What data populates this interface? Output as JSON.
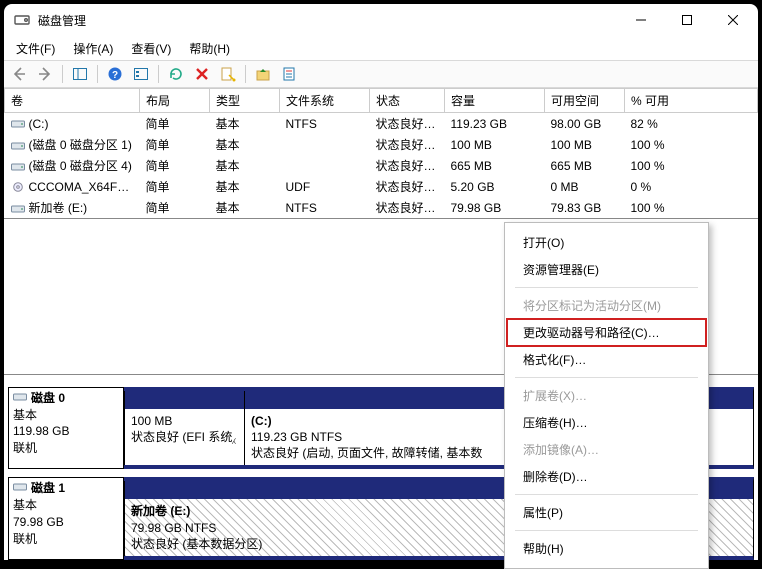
{
  "title": "磁盘管理",
  "menus": {
    "file": "文件(F)",
    "action": "操作(A)",
    "view": "查看(V)",
    "help": "帮助(H)"
  },
  "columns": {
    "volume": "卷",
    "layout": "布局",
    "type": "类型",
    "fs": "文件系统",
    "status": "状态",
    "capacity": "容量",
    "free": "可用空间",
    "pct": "% 可用"
  },
  "volumes": [
    {
      "name": "(C:)",
      "layout": "简单",
      "type": "基本",
      "fs": "NTFS",
      "status": "状态良好 (…",
      "capacity": "119.23 GB",
      "free": "98.00 GB",
      "pct": "82 %",
      "icon": "drive"
    },
    {
      "name": "(磁盘 0 磁盘分区 1)",
      "layout": "简单",
      "type": "基本",
      "fs": "",
      "status": "状态良好 (…",
      "capacity": "100 MB",
      "free": "100 MB",
      "pct": "100 %",
      "icon": "drive"
    },
    {
      "name": "(磁盘 0 磁盘分区 4)",
      "layout": "简单",
      "type": "基本",
      "fs": "",
      "status": "状态良好 (…",
      "capacity": "665 MB",
      "free": "665 MB",
      "pct": "100 %",
      "icon": "drive"
    },
    {
      "name": "CCCOMA_X64FR…",
      "layout": "简单",
      "type": "基本",
      "fs": "UDF",
      "status": "状态良好 (…",
      "capacity": "5.20 GB",
      "free": "0 MB",
      "pct": "0 %",
      "icon": "cd"
    },
    {
      "name": "新加卷 (E:)",
      "layout": "简单",
      "type": "基本",
      "fs": "NTFS",
      "status": "状态良好 (…",
      "capacity": "79.98 GB",
      "free": "79.83 GB",
      "pct": "100 %",
      "icon": "drive"
    }
  ],
  "disks": [
    {
      "name": "磁盘 0",
      "type": "基本",
      "size": "119.98 GB",
      "state": "联机",
      "parts": [
        {
          "title": "",
          "line2": "100 MB",
          "line3": "状态良好 (EFI 系统⁁",
          "width": 120
        },
        {
          "title": "(C:)",
          "line2": "119.23 GB NTFS",
          "line3": "状态良好 (启动, 页面文件, 故障转储, 基本数",
          "width": 0
        }
      ]
    },
    {
      "name": "磁盘 1",
      "type": "基本",
      "size": "79.98 GB",
      "state": "联机",
      "parts": [
        {
          "title": "新加卷  (E:)",
          "line2": "79.98 GB NTFS",
          "line3": "状态良好 (基本数据分区)",
          "width": 0,
          "hatched": true
        }
      ]
    }
  ],
  "ctx": {
    "open": "打开(O)",
    "explore": "资源管理器(E)",
    "markActive": "将分区标记为活动分区(M)",
    "changeLetter": "更改驱动器号和路径(C)…",
    "format": "格式化(F)…",
    "extend": "扩展卷(X)…",
    "shrink": "压缩卷(H)…",
    "mirror": "添加镜像(A)…",
    "delete": "删除卷(D)…",
    "props": "属性(P)",
    "help": "帮助(H)"
  }
}
